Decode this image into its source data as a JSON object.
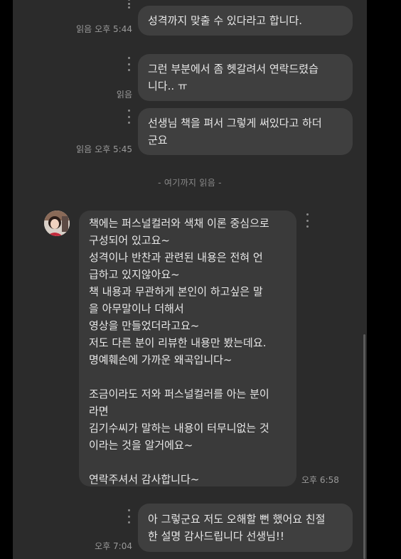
{
  "messages": [
    {
      "side": "me",
      "lines": [
        "성격까지 맞출 수 있다라고 합니다."
      ],
      "read": "읽음",
      "time": "오후 5:44"
    },
    {
      "side": "me",
      "lines": [
        "그런 부분에서 좀 헷갈려서 연락드렸습",
        "니다.. ㅠ"
      ],
      "read": "읽음",
      "time": ""
    },
    {
      "side": "me",
      "lines": [
        "선생님 책을 펴서 그렇게 써있다고 하더",
        "군요"
      ],
      "read": "읽음",
      "time": "오후 5:45"
    },
    {
      "side": "them",
      "lines": [
        "책에는 퍼스널컬러와 색채 이론 중심으로",
        "구성되어 있고요~",
        "성격이나 반찬과 관련된 내용은 전혀 언",
        "급하고 있지않아요~",
        "책 내용과 무관하게 본인이 하고싶은 말",
        "을 아무말이나 더해서",
        "영상을 만들었더라고요~",
        "저도 다른 분이 리뷰한 내용만 봤는데요.",
        "명예훼손에 가까운 왜곡입니다~",
        "",
        "조금이라도 저와 퍼스널컬러를 아는 분이",
        "라면",
        "김기수씨가 말하는 내용이 터무니없는 것",
        "이라는 것을 알거에요~",
        "",
        "연락주셔서 감사합니다~"
      ],
      "time": "오후 6:58"
    },
    {
      "side": "me",
      "lines": [
        "아 그렇군요 저도 오해할 뻔 했어요 친절",
        "한 설명 감사드립니다 선생님!!"
      ],
      "read": "",
      "time": "오후 7:04"
    }
  ],
  "divider": "- 여기까지 읽음 -",
  "colors": {
    "background": "#2b2b2b",
    "bubble_me": "#3f3f3f",
    "bubble_them": "#3a3a3a",
    "text": "#e8e8e8",
    "meta": "#9a9a9a"
  },
  "icons": {
    "message_menu": "more-vertical-icon",
    "avatar": "avatar-photo"
  }
}
